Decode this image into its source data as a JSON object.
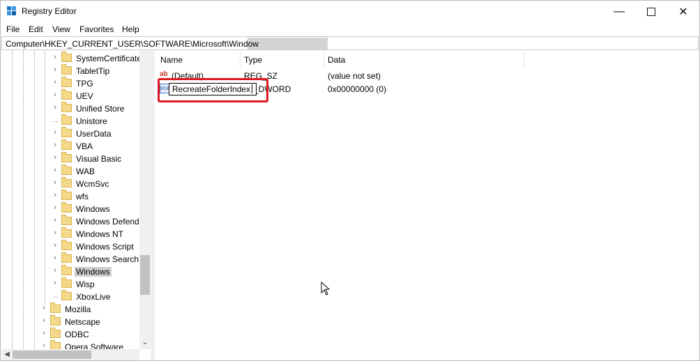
{
  "window": {
    "title": "Registry Editor"
  },
  "menu": [
    "File",
    "Edit",
    "View",
    "Favorites",
    "Help"
  ],
  "address": "Computer\\HKEY_CURRENT_USER\\SOFTWARE\\Microsoft\\Window",
  "tree": {
    "items": [
      {
        "label": "SystemCertificate",
        "expandable": true
      },
      {
        "label": "TabletTip",
        "expandable": true
      },
      {
        "label": "TPG",
        "expandable": true
      },
      {
        "label": "UEV",
        "expandable": true
      },
      {
        "label": "Unified Store",
        "expandable": true
      },
      {
        "label": "Unistore",
        "expandable": false
      },
      {
        "label": "UserData",
        "expandable": true
      },
      {
        "label": "VBA",
        "expandable": true
      },
      {
        "label": "Visual Basic",
        "expandable": true
      },
      {
        "label": "WAB",
        "expandable": true
      },
      {
        "label": "WcmSvc",
        "expandable": true
      },
      {
        "label": "wfs",
        "expandable": true
      },
      {
        "label": "Windows",
        "expandable": true
      },
      {
        "label": "Windows Defend",
        "expandable": true
      },
      {
        "label": "Windows NT",
        "expandable": true
      },
      {
        "label": "Windows Script",
        "expandable": true
      },
      {
        "label": "Windows Search",
        "expandable": true
      },
      {
        "label": "Windows",
        "expandable": true,
        "selected": true
      },
      {
        "label": "Wisp",
        "expandable": true
      },
      {
        "label": "XboxLive",
        "expandable": false
      }
    ],
    "parent_items": [
      {
        "label": "Mozilla",
        "expandable": true
      },
      {
        "label": "Netscape",
        "expandable": true
      },
      {
        "label": "ODBC",
        "expandable": true
      },
      {
        "label": "Opera Software",
        "expandable": true
      }
    ]
  },
  "list": {
    "columns": {
      "name": "Name",
      "type": "Type",
      "data": "Data"
    },
    "rows": [
      {
        "icon": "string-value-icon",
        "icon_text": "ab",
        "name": "(Default)",
        "type": "REG_SZ",
        "data": "(value not set)"
      },
      {
        "icon": "binary-value-icon",
        "icon_text": "010",
        "name": "",
        "type": "_DWORD",
        "data": "0x00000000 (0)"
      }
    ],
    "rename_value": "RecreateFolderIndex"
  },
  "colors": {
    "highlight": "#e01a22",
    "folder": "#f4d98b"
  }
}
